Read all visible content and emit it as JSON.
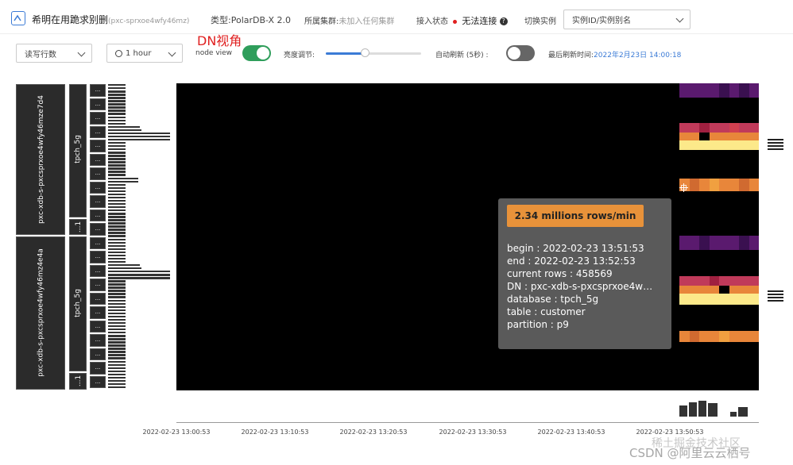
{
  "header": {
    "title": "希明在用跪求别删",
    "instance_id": "(pxc-sprxoe4wfy46mz)",
    "type_label": "类型:",
    "type_value": "PolarDB-X 2.0",
    "cluster_label": "所属集群:",
    "cluster_value": "未加入任何集群",
    "access_label": "接入状态",
    "access_value": "无法连接",
    "access_status_color": "#e02020",
    "switch_label": "切换实例",
    "switch_placeholder": "实例ID/实例别名"
  },
  "annotation": "DN视角",
  "toolbar": {
    "metric": "读写行数",
    "range": "1 hour",
    "node_view_label": "node view",
    "node_view_on": true,
    "brightness_label": "亮度调节:",
    "brightness_level": 0.41,
    "auto_refresh_label": "自动刷新 (5秒) :",
    "auto_refresh_on": false,
    "last_refresh_label": "最后刷新时间:",
    "last_refresh_value": "2022年2月23日 14:00:18"
  },
  "heatmap": {
    "dn_nodes": [
      "pxc-xdb-s-pxcsprxoe4wfy46mze7d4",
      "pxc-xdb-s-pxcsprxoe4wfy46mz4e4a"
    ],
    "databases": [
      "tpch_5g",
      "tpch_5g"
    ],
    "truncated_label": "...1",
    "cell_label": "...",
    "time_ticks": [
      "2022-02-23 13:00:53",
      "2022-02-23 13:10:53",
      "2022-02-23 13:20:53",
      "2022-02-23 13:30:53",
      "2022-02-23 13:40:53",
      "2022-02-23 13:50:53"
    ],
    "colors": {
      "bg": "#000000",
      "hot": "#fce98a",
      "warm": "#e8863a",
      "mid": "#c03a5a",
      "cool": "#5a1a6e"
    }
  },
  "tooltip": {
    "headline": "2.34 millions rows/min",
    "headline_bg": "#e8923a",
    "begin": "begin : 2022-02-23 13:51:53",
    "end": "end : 2022-02-23 13:52:53",
    "current_rows": "current rows : 458569",
    "dn": "DN : pxc-xdb-s-pxcsprxoe4w…",
    "database": "database : tpch_5g",
    "table": "table : customer",
    "partition": "partition : p9"
  },
  "watermark": "CSDN @阿里云云栖号",
  "watermark2": "稀土掘金技术社区"
}
